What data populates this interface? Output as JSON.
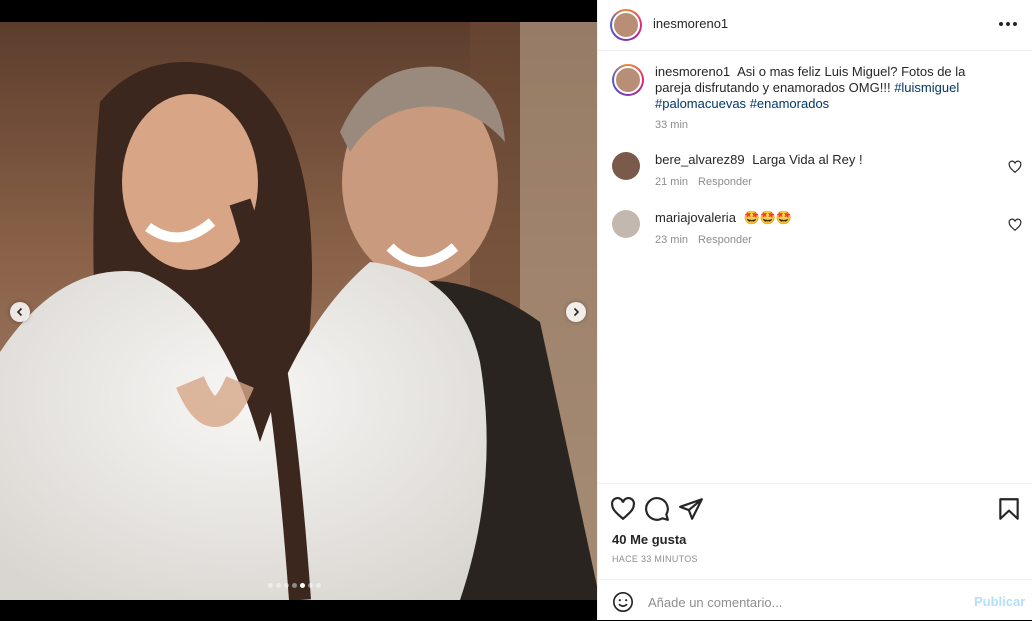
{
  "post": {
    "author": "inesmoreno1",
    "caption_text": "Asi o mas feliz Luis Miguel? Fotos de la pareja disfrutando y enamorados OMG!!!",
    "hashtags": [
      "#luismiguel",
      "#palomacuevas",
      "#enamorados"
    ],
    "caption_time": "33 min",
    "likes": "40 Me gusta",
    "posted_ago": "HACE 33 MINUTOS",
    "carousel_total": 7,
    "carousel_active_index": 4
  },
  "comments": [
    {
      "user": "bere_alvarez89",
      "text": "Larga Vida al Rey !",
      "time": "21 min",
      "reply_label": "Responder"
    },
    {
      "user": "mariajovaleria",
      "text": "🤩🤩🤩",
      "time": "23 min",
      "reply_label": "Responder"
    }
  ],
  "composer": {
    "placeholder": "Añade un comentario...",
    "publish_label": "Publicar"
  },
  "icons": {
    "more": "more-options-icon",
    "like": "heart-icon",
    "comment": "comment-icon",
    "share": "send-icon",
    "save": "bookmark-icon",
    "emoji": "emoji-icon",
    "prev": "chevron-left-icon",
    "next": "chevron-right-icon"
  }
}
